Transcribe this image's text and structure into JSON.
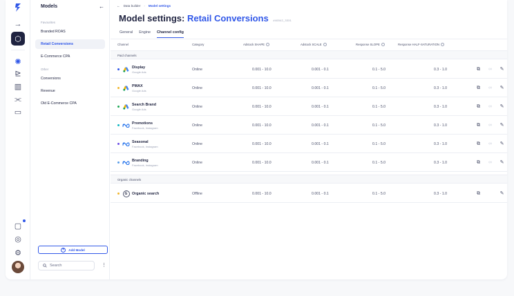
{
  "rail": {
    "items": [
      {
        "name": "back-arrow-icon",
        "glyph": "→"
      },
      {
        "name": "cube-icon",
        "glyph": "◈"
      },
      {
        "name": "brain-icon",
        "glyph": "❂"
      },
      {
        "name": "flow-icon",
        "glyph": "⧉"
      },
      {
        "name": "buildings-icon",
        "glyph": "▥"
      },
      {
        "name": "sliders-icon",
        "glyph": "⫨"
      },
      {
        "name": "monitor-icon",
        "glyph": "▭"
      }
    ],
    "bottom": [
      {
        "name": "chat-icon",
        "glyph": "☐"
      },
      {
        "name": "help-icon",
        "glyph": "◎"
      },
      {
        "name": "settings-icon",
        "glyph": "⚙"
      }
    ]
  },
  "models": {
    "title": "Models",
    "favourites_label": "Favourites",
    "favourites": [
      "Branded ROAS",
      "Retail Conversions",
      "E-Commerce CPA"
    ],
    "other_label": "Other",
    "other": [
      "Conversions",
      "Revenue",
      "Old E-Commerce CPA"
    ],
    "add_label": "Add Model",
    "search_placeholder": "Search"
  },
  "breadcrumb": {
    "back": "Data builder",
    "current": "Model settings"
  },
  "page": {
    "title_prefix": "Model settings:",
    "title_model": "Retail Conversions",
    "model_id": "#46542_3331"
  },
  "tabs": [
    {
      "label": "General",
      "active": false
    },
    {
      "label": "Engine",
      "active": false
    },
    {
      "label": "Channel config",
      "active": true
    }
  ],
  "table": {
    "headers": {
      "channel": "Channel",
      "category": "Category",
      "shape": "Adstock SHAPE",
      "scale": "Adstock SCALE",
      "slope": "Response SLOPE",
      "half": "Response HALF-SATURATION"
    },
    "paid_label": "Paid channels",
    "organic_label": "Organic channels",
    "paid_rows": [
      {
        "name": "Display",
        "source": "Google Ads",
        "logo": "google-ads",
        "dot": "#3057e8",
        "category": "Online",
        "shape": "0.001 - 10.0",
        "scale": "0.001 - 0.1",
        "slope": "0.1 - 5.0",
        "half": "0.3 - 1.0"
      },
      {
        "name": "PMAX",
        "source": "Google Ads",
        "logo": "google-ads",
        "dot": "#f2b62c",
        "category": "Online",
        "shape": "0.001 - 10.0",
        "scale": "0.001 - 0.1",
        "slope": "0.1 - 5.0",
        "half": "0.3 - 1.0"
      },
      {
        "name": "Search Brand",
        "source": "Google Ads",
        "logo": "google-ads",
        "dot": "#1fa855",
        "category": "Online",
        "shape": "0.001 - 10.0",
        "scale": "0.001 - 0.1",
        "slope": "0.1 - 5.0",
        "half": "0.3 - 1.0"
      },
      {
        "name": "Promotions",
        "source": "Facebook, Instagram",
        "logo": "meta",
        "dot": "#14b8c4",
        "category": "Online",
        "shape": "0.001 - 10.0",
        "scale": "0.001 - 0.1",
        "slope": "0.1 - 5.0",
        "half": "0.3 - 1.0"
      },
      {
        "name": "Seasonal",
        "source": "Facebook, Instagram",
        "logo": "meta",
        "dot": "#6b4ee6",
        "category": "Online",
        "shape": "0.001 - 10.0",
        "scale": "0.001 - 0.1",
        "slope": "0.1 - 5.0",
        "half": "0.3 - 1.0"
      },
      {
        "name": "Branding",
        "source": "Facebook, Instagram",
        "logo": "meta",
        "dot": "#5a9ee8",
        "category": "Online",
        "shape": "0.001 - 10.0",
        "scale": "0.001 - 0.1",
        "slope": "0.1 - 5.0",
        "half": "0.3 - 1.0"
      }
    ],
    "organic_rows": [
      {
        "name": "Organic search",
        "source": "",
        "logo": "organic",
        "dot": "#f2b62c",
        "category": "Offline",
        "shape": "0.001 - 10.0",
        "scale": "0.001 - 0.1",
        "slope": "0.1 - 5.0",
        "half": "0.3 - 1.0"
      }
    ]
  },
  "colors": {
    "accent": "#3057e8",
    "text": "#1f2340",
    "muted": "#9aa0b4"
  }
}
